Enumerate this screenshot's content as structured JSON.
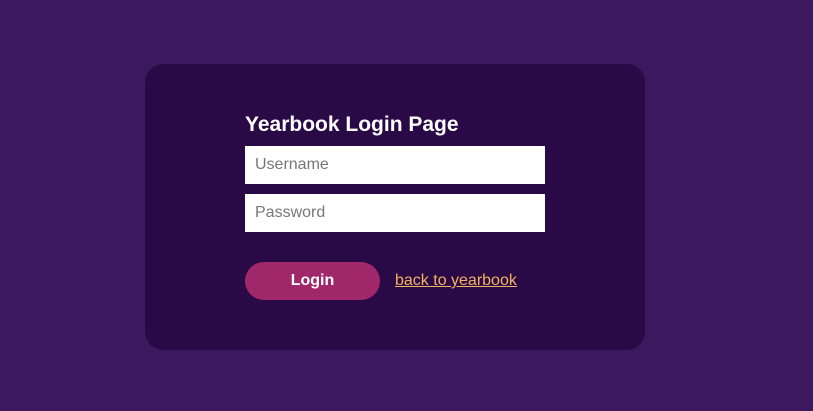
{
  "login": {
    "title": "Yearbook Login Page",
    "username_placeholder": "Username",
    "password_placeholder": "Password",
    "login_label": "Login",
    "back_link_label": "back to yearbook"
  },
  "colors": {
    "page_background": "#3c195e",
    "card_background": "#2a0a46",
    "button_background": "#a0276a",
    "link_color": "#f4b25f"
  }
}
